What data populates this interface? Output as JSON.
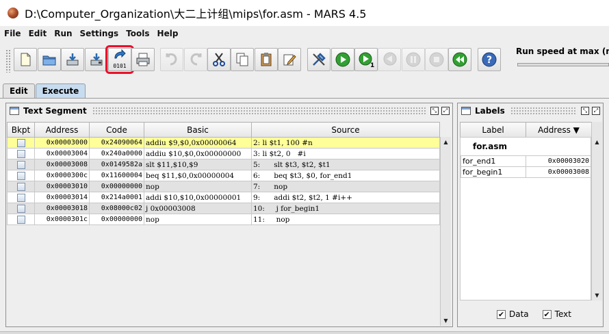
{
  "window": {
    "title": "D:\\Computer_Organization\\大二上计组\\mips\\for.asm  - MARS 4.5"
  },
  "menu": [
    "File",
    "Edit",
    "Run",
    "Settings",
    "Tools",
    "Help"
  ],
  "toolbar": {
    "assemble_badge": "0101",
    "run_speed_label": "Run speed at max (no interaction)"
  },
  "tabs": [
    {
      "label": "Edit",
      "active": false
    },
    {
      "label": "Execute",
      "active": true
    }
  ],
  "text_segment": {
    "title": "Text Segment",
    "columns": [
      "Bkpt",
      "Address",
      "Code",
      "Basic",
      "Source"
    ],
    "rows": [
      {
        "address": "0x00003000",
        "code": "0x24090064",
        "basic": "addiu $9,$0,0x00000064",
        "source": "2: li $t1, 100 #n",
        "current": true
      },
      {
        "address": "0x00003004",
        "code": "0x240a0000",
        "basic": "addiu $10,$0,0x00000000",
        "source": "3: li $t2, 0   #i",
        "current": false
      },
      {
        "address": "0x00003008",
        "code": "0x0149582a",
        "basic": "slt $11,$10,$9",
        "source": "5:      slt $t3, $t2, $t1",
        "current": false
      },
      {
        "address": "0x0000300c",
        "code": "0x11600004",
        "basic": "beq $11,$0,0x00000004",
        "source": "6:      beq $t3, $0, for_end1",
        "current": false
      },
      {
        "address": "0x00003010",
        "code": "0x00000000",
        "basic": "nop",
        "source": "7:      nop",
        "current": false
      },
      {
        "address": "0x00003014",
        "code": "0x214a0001",
        "basic": "addi $10,$10,0x00000001",
        "source": "9:      addi $t2, $t2, 1 #i++",
        "current": false
      },
      {
        "address": "0x00003018",
        "code": "0x08000c02",
        "basic": "j 0x00003008",
        "source": "10:     j for_begin1",
        "current": false
      },
      {
        "address": "0x0000301c",
        "code": "0x00000000",
        "basic": "nop",
        "source": "11:     nop",
        "current": false
      }
    ]
  },
  "labels": {
    "title": "Labels",
    "columns": [
      "Label",
      "Address ▼"
    ],
    "file": "for.asm",
    "rows": [
      {
        "label": "for_end1",
        "address": "0x00003020"
      },
      {
        "label": "for_begin1",
        "address": "0x00003008"
      }
    ],
    "footer": {
      "data_label": "Data",
      "text_label": "Text",
      "data_checked": true,
      "text_checked": true
    }
  }
}
